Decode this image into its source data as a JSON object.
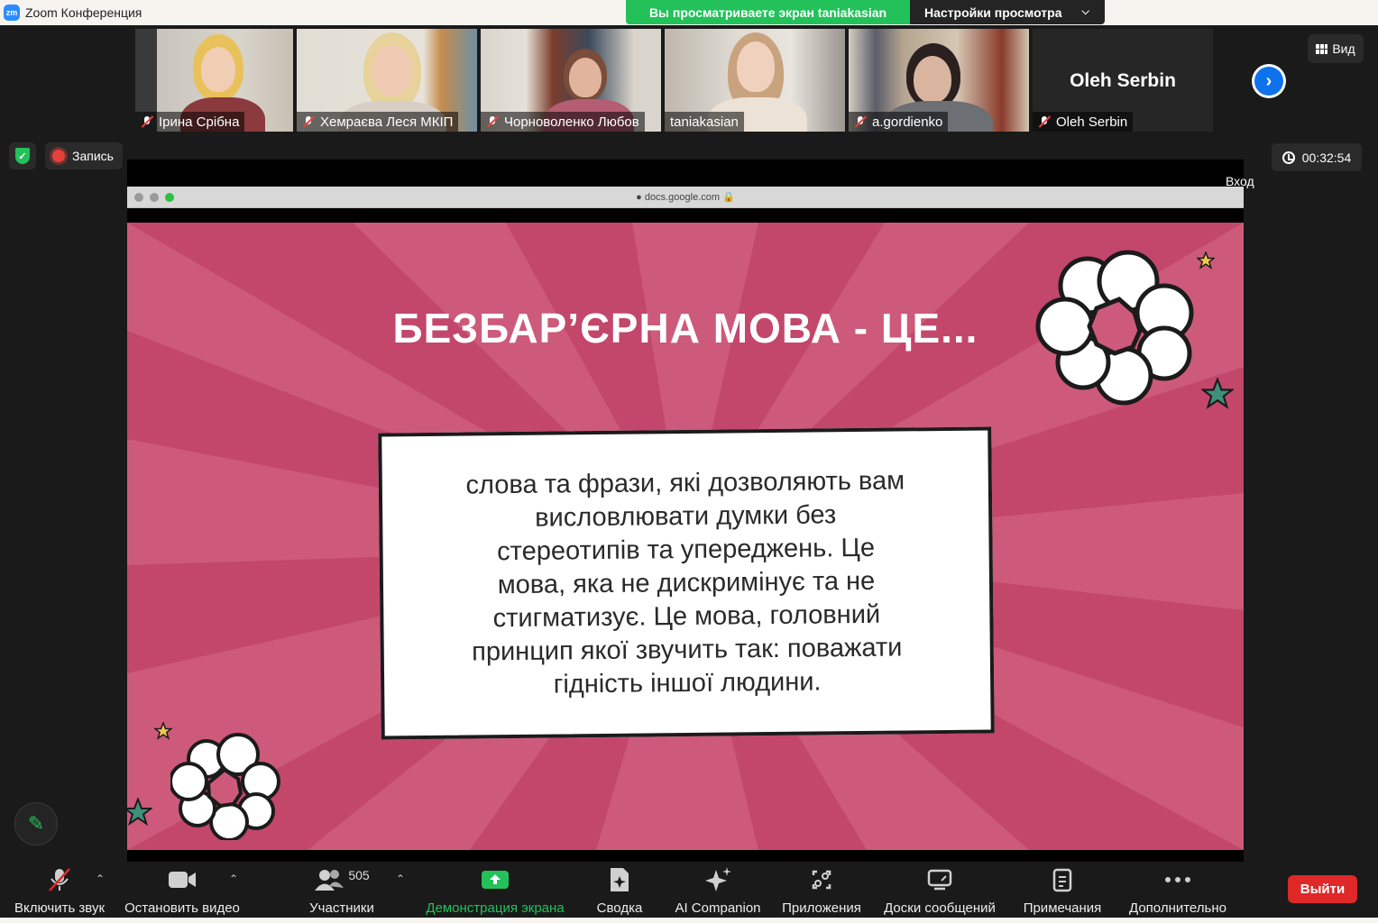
{
  "window": {
    "logo": "zm",
    "title": "Zoom Конференция"
  },
  "share_banner": {
    "viewing": "Вы просматриваете экран taniakasian",
    "view_settings": "Настройки просмотра"
  },
  "participants_strip": [
    {
      "name": "Ірина Срібна",
      "muted": true
    },
    {
      "name": "Хемраєва Леся МКІП",
      "muted": true
    },
    {
      "name": "Чорноволенко Любов",
      "muted": true
    },
    {
      "name": "taniakasian",
      "muted": false
    },
    {
      "name": "a.gordienko",
      "muted": true
    },
    {
      "name": "Oleh Serbin",
      "muted": true,
      "video_off": true
    }
  ],
  "view_button": "Вид",
  "recording": {
    "label": "Запись"
  },
  "timer": "00:32:54",
  "login_label": "Вход",
  "browser": {
    "url": "docs.google.com"
  },
  "slide": {
    "title": "БЕЗБАР’ЄРНА МОВА  - ЦЕ...",
    "body_lines": [
      "слова та фрази, які дозволяють вам",
      "висловлювати думки без",
      "стереотипів та упереджень. Це",
      "мова, яка не дискримінує та не",
      "стигматизує. Це мова, головний",
      "принцип якої звучить так: поважати",
      "гідність іншої людини."
    ],
    "colors": {
      "background": "#cd5a7a",
      "rays": "#c2476b"
    }
  },
  "toolbar": {
    "unmute": "Включить звук",
    "stop_video": "Остановить видео",
    "participants": "Участники",
    "participants_count": "505",
    "share_screen": "Демонстрация экрана",
    "summary": "Сводка",
    "ai_companion": "AI Companion",
    "apps": "Приложения",
    "whiteboards": "Доски сообщений",
    "notes": "Примечания",
    "more": "Дополнительно",
    "leave": "Выйти"
  }
}
